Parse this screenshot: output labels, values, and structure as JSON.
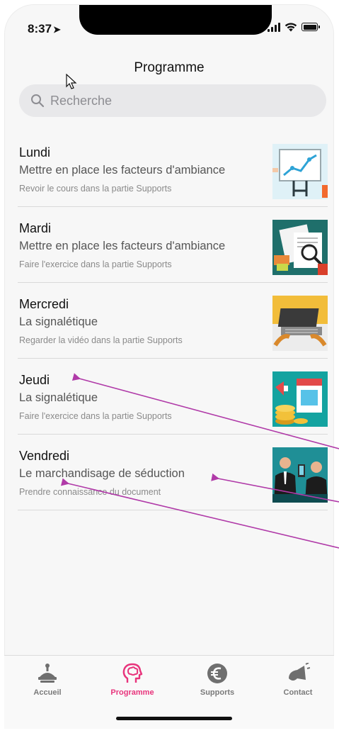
{
  "status": {
    "time": "8:37",
    "location_icon": "location-arrow-icon"
  },
  "header": {
    "title": "Programme"
  },
  "search": {
    "placeholder": "Recherche",
    "value": ""
  },
  "program": {
    "items": [
      {
        "day": "Lundi",
        "subject": "Mettre en place les facteurs d'ambiance",
        "task": "Revoir le cours dans la partie Supports",
        "image": "presentation-board-image"
      },
      {
        "day": "Mardi",
        "subject": "Mettre en place les facteurs d'ambiance",
        "task": "Faire l'exercice dans la partie Supports",
        "image": "newspaper-magnifier-image"
      },
      {
        "day": "Mercredi",
        "subject": "La signalétique",
        "task": "Regarder la vidéo dans la partie Supports",
        "image": "laptop-hands-image"
      },
      {
        "day": "Jeudi",
        "subject": "La signalétique",
        "task": "Faire l'exercice dans la partie Supports",
        "image": "shop-coins-image"
      },
      {
        "day": "Vendredi",
        "subject": "Le marchandisage de séduction",
        "task": "Prendre connaissance du document",
        "image": "business-meeting-image"
      }
    ]
  },
  "tabbar": {
    "tabs": [
      {
        "label": "Accueil",
        "icon": "hanger-icon",
        "active": false
      },
      {
        "label": "Programme",
        "icon": "brain-head-icon",
        "active": true
      },
      {
        "label": "Supports",
        "icon": "euro-icon",
        "active": false
      },
      {
        "label": "Contact",
        "icon": "megaphone-icon",
        "active": false
      }
    ]
  },
  "colors": {
    "accent": "#e8347c",
    "annotation": "#b03aa8",
    "tab_inactive": "#7a7a7a"
  }
}
